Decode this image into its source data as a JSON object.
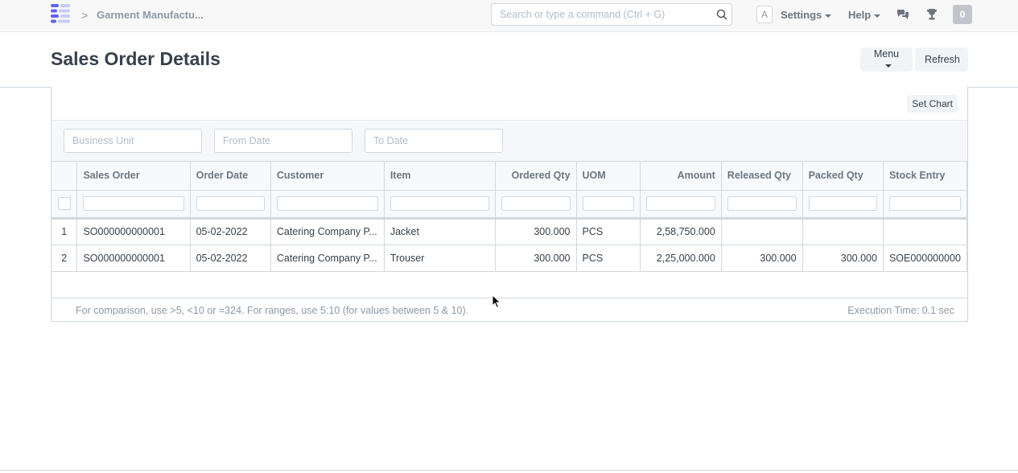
{
  "navbar": {
    "breadcrumb": "Garment Manufactu...",
    "breadcrumb_sep": ">",
    "search_placeholder": "Search or type a command (Ctrl + G)",
    "avatar_letter": "A",
    "settings_label": "Settings",
    "help_label": "Help",
    "notification_count": "0"
  },
  "page": {
    "title": "Sales Order Details",
    "menu_label": "Menu",
    "refresh_label": "Refresh"
  },
  "report": {
    "set_chart_label": "Set Chart",
    "filters": [
      {
        "placeholder": "Business Unit"
      },
      {
        "placeholder": "From Date"
      },
      {
        "placeholder": "To Date"
      }
    ],
    "columns": [
      "Sales Order",
      "Order Date",
      "Customer",
      "Item",
      "Ordered Qty",
      "UOM",
      "Amount",
      "Released Qty",
      "Packed Qty",
      "Stock Entry"
    ],
    "rows": [
      {
        "n": "1",
        "sales_order": "SO000000000001",
        "order_date": "05-02-2022",
        "customer": "Catering Company P...",
        "item": "Jacket",
        "ordered_qty": "300.000",
        "uom": "PCS",
        "amount": "2,58,750.000",
        "released_qty": "",
        "packed_qty": "",
        "stock_entry": ""
      },
      {
        "n": "2",
        "sales_order": "SO000000000001",
        "order_date": "05-02-2022",
        "customer": "Catering Company P...",
        "item": "Trouser",
        "ordered_qty": "300.000",
        "uom": "PCS",
        "amount": "2,25,000.000",
        "released_qty": "300.000",
        "packed_qty": "300.000",
        "stock_entry": "SOE000000000"
      }
    ],
    "footer_hint": "For comparison, use >5, <10 or =324. For ranges, use 5:10 (for values between 5 & 10).",
    "execution_time": "Execution Time: 0.1 sec"
  },
  "colors": {
    "accent": "#5e64ff",
    "text": "#36414c",
    "muted": "#8d99a6",
    "border": "#d1d8dd"
  }
}
